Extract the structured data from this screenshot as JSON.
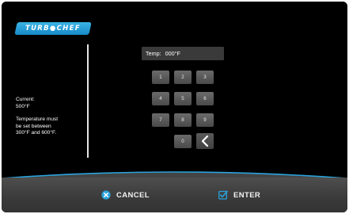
{
  "brand": {
    "logo_text": "TURB●CHEF",
    "color": "#2aa3dc"
  },
  "info": {
    "current_label": "Current:",
    "current_value": "500°F",
    "constraint_lines": [
      "Temperature must",
      "be set between",
      "300°F and 600°F."
    ]
  },
  "temp_field": {
    "label": "Temp:",
    "value": "000°F"
  },
  "keypad": {
    "keys": [
      "1",
      "2",
      "3",
      "4",
      "5",
      "6",
      "7",
      "8",
      "9",
      "0"
    ],
    "backspace_icon": "chevron-left-icon"
  },
  "footer": {
    "cancel_label": "CANCEL",
    "cancel_icon": "cancel-x-circle-icon",
    "enter_label": "ENTER",
    "enter_icon": "check-box-icon",
    "accent_color": "#2aa3dc"
  }
}
